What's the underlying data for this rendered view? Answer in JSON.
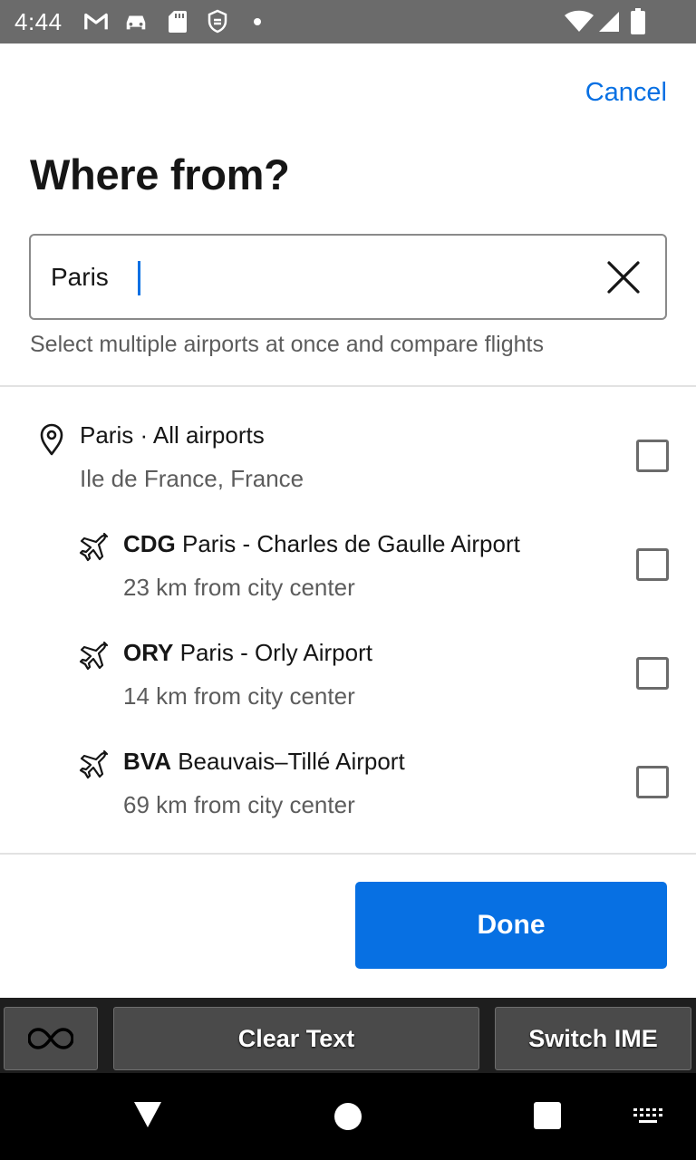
{
  "status_bar": {
    "time": "4:44",
    "icons": [
      "gmail-icon",
      "car-icon",
      "sd-card-icon",
      "shield-sync-icon",
      "notification-dot",
      "wifi-icon",
      "signal-icon",
      "battery-icon"
    ]
  },
  "header": {
    "cancel_label": "Cancel",
    "title": "Where from?"
  },
  "search": {
    "value": "Paris",
    "hint": "Select multiple airports at once and compare flights"
  },
  "results": [
    {
      "type": "city",
      "code": "",
      "name": "Paris · All airports",
      "sub": "Ile de France, France",
      "checked": false
    },
    {
      "type": "airport",
      "code": "CDG",
      "name": " Paris - Charles de Gaulle Airport",
      "sub": "23 km from city center",
      "checked": false
    },
    {
      "type": "airport",
      "code": "ORY",
      "name": " Paris - Orly Airport",
      "sub": "14 km from city center",
      "checked": false
    },
    {
      "type": "airport",
      "code": "BVA",
      "name": " Beauvais–Tillé Airport",
      "sub": "69 km from city center",
      "checked": false
    }
  ],
  "done_label": "Done",
  "ime": {
    "clear_text": "Clear Text",
    "switch_ime": "Switch IME"
  },
  "colors": {
    "accent": "#0770e3",
    "status_bar": "#6b6b6b",
    "text_primary": "#161616",
    "text_secondary": "#5c5c5c"
  }
}
